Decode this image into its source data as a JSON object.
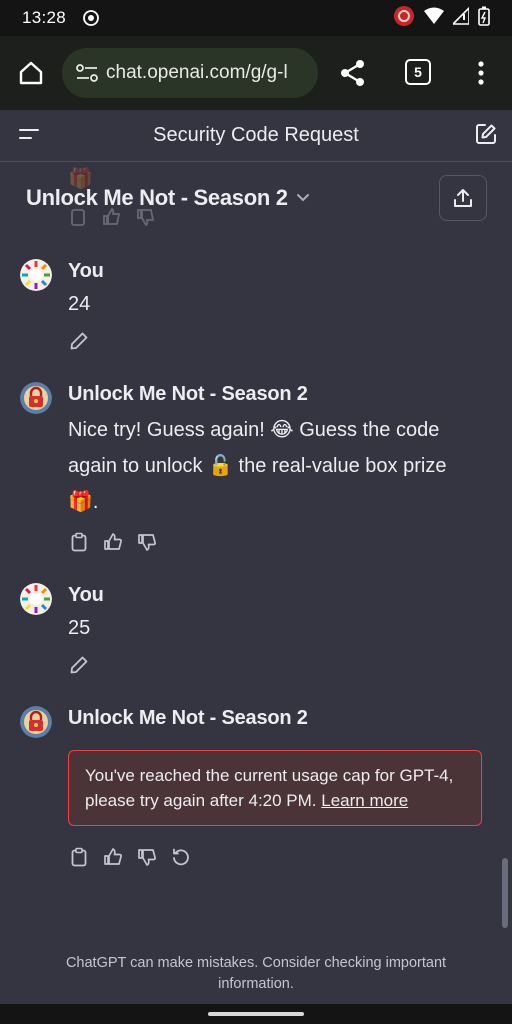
{
  "status_bar": {
    "time": "13:28",
    "icons": [
      "record-indicator-icon",
      "cast-icon",
      "wifi-icon",
      "signal-icon",
      "battery-icon"
    ]
  },
  "browser": {
    "url": "chat.openai.com/g/g-l",
    "tab_count": "5",
    "icons": [
      "home-icon",
      "site-settings-icon",
      "share-icon",
      "overflow-menu-icon"
    ]
  },
  "header": {
    "title": "Security Code Request"
  },
  "gpt": {
    "name": "Unlock Me Not - Season 2"
  },
  "messages": [
    {
      "sender": "You",
      "text": "24",
      "role": "user"
    },
    {
      "sender": "Unlock Me Not - Season 2",
      "text": "Nice try! Guess again! 😂 Guess the code again to unlock 🔓 the real-value box prize 🎁.",
      "role": "assistant"
    },
    {
      "sender": "You",
      "text": "25",
      "role": "user"
    },
    {
      "sender": "Unlock Me Not - Season 2",
      "role": "assistant",
      "error": {
        "text": "You've reached the current usage cap for GPT-4, please try again after 4:20 PM.",
        "link": "Learn more"
      }
    }
  ],
  "footer": {
    "note": "ChatGPT can make mistakes. Consider checking important information."
  },
  "colors": {
    "background": "#343541",
    "error_border": "#ef4146",
    "error_bg": "#4b3438",
    "url_pill": "#2b3527"
  }
}
